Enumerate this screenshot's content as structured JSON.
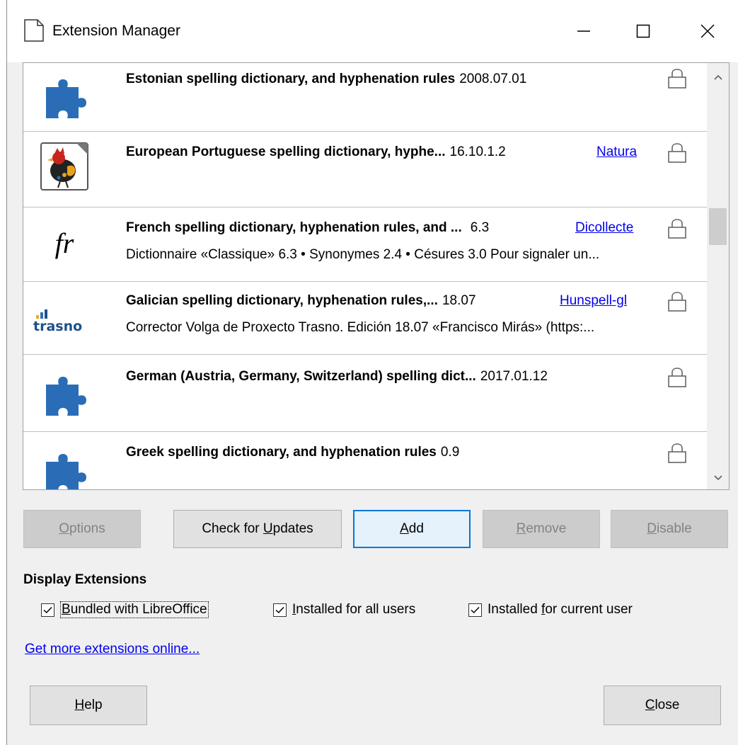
{
  "window": {
    "title": "Extension Manager",
    "controls": [
      "minimize",
      "maximize",
      "close"
    ]
  },
  "extensions": [
    {
      "icon": "puzzle-icon",
      "name": "Estonian spelling dictionary, and hyphenation rules",
      "version": "2008.07.01",
      "publisher": "",
      "description": ""
    },
    {
      "icon": "rooster-icon",
      "name": "European Portuguese spelling dictionary, hyphe...",
      "version": "16.10.1.2",
      "publisher": "Natura",
      "description": ""
    },
    {
      "icon": "fr-icon",
      "icon_text": "fr",
      "name": "French spelling dictionary, hyphenation rules, and ...",
      "version": "6.3",
      "publisher": "Dicollecte",
      "description": "Dictionnaire «Classique» 6.3 • Synonymes 2.4 • Césures 3.0  Pour signaler un..."
    },
    {
      "icon": "trasno-logo-icon",
      "icon_text": "trasno",
      "name": "Galician spelling dictionary, hyphenation rules,...",
      "version": "18.07",
      "publisher": "Hunspell-gl",
      "description": "Corrector Volga de Proxecto Trasno.  Edición 18.07 «Francisco Mirás» (https:..."
    },
    {
      "icon": "puzzle-icon",
      "name": "German (Austria, Germany, Switzerland) spelling dict...",
      "version": "2017.01.12",
      "publisher": "",
      "description": ""
    },
    {
      "icon": "puzzle-icon",
      "name": "Greek spelling dictionary, and hyphenation rules",
      "version": "0.9",
      "publisher": "",
      "description": ""
    }
  ],
  "buttons": {
    "options": {
      "label": "Options",
      "mnemonic": "O",
      "rest": "ptions"
    },
    "check_updates": {
      "prefix": "Check for ",
      "mnemonic": "U",
      "rest": "pdates"
    },
    "add": {
      "mnemonic": "A",
      "rest": "dd"
    },
    "remove": {
      "mnemonic": "R",
      "rest": "emove"
    },
    "disable": {
      "mnemonic": "D",
      "rest": "isable"
    }
  },
  "display_extensions": {
    "title": "Display Extensions",
    "bundled": {
      "mnemonic": "B",
      "rest": "undled with LibreOffice",
      "checked": true
    },
    "all_users": {
      "mnemonic": "I",
      "rest": "nstalled for all users",
      "checked": true
    },
    "current_user": {
      "prefix": "Installed ",
      "mnemonic": "f",
      "rest": "or current user",
      "checked": true
    }
  },
  "more_link": "Get more extensions online...",
  "footer": {
    "help": {
      "mnemonic": "H",
      "rest": "elp"
    },
    "close": {
      "mnemonic": "C",
      "rest": "lose"
    }
  },
  "colors": {
    "link": "#0000ee",
    "focus_border": "#0078d7",
    "puzzle_blue": "#2a6db6"
  }
}
